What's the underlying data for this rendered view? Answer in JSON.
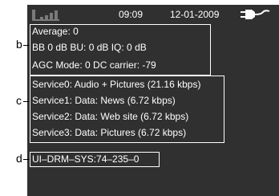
{
  "status_bar": {
    "time": "09:09",
    "date": "12-01-2009",
    "icons": [
      "signal-strength-icon",
      "power-plug-icon"
    ]
  },
  "panels": {
    "b": {
      "label": "b",
      "lines": [
        "Average: 0",
        "BB 0 dB BU: 0 dB IQ: 0 dB",
        "AGC Mode: 0 DC carrier: -79"
      ]
    },
    "c": {
      "label": "c",
      "lines": [
        "Service0: Audio + Pictures (21.16 kbps)",
        "Service1: Data: News (6.72 kbps)",
        "Service2: Data: Web site (6.72 kbps)",
        "Service3: Data: Pictures (6.72 kbps)"
      ]
    },
    "d": {
      "label": "d",
      "lines": [
        "UI–DRM–SYS:74–235–0"
      ]
    }
  },
  "colors": {
    "screen_bg": "#303030",
    "text": "#ffffff",
    "dim_icon": "#7a7a7a"
  }
}
